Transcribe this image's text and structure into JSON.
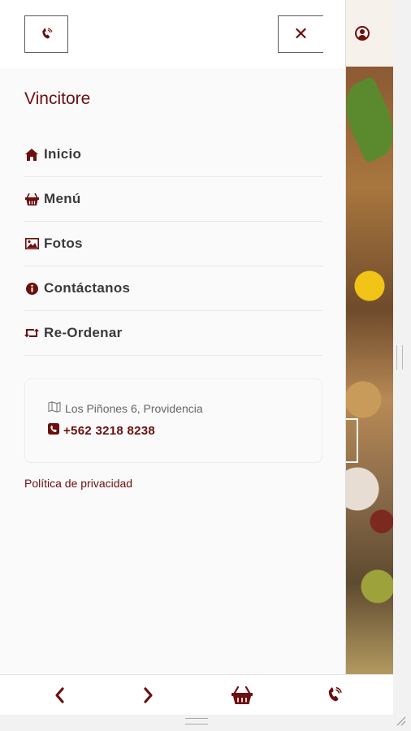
{
  "header": {
    "phone_icon": "phone-icon",
    "close_icon": "close-icon",
    "close_glyph": "✕",
    "user_icon": "user-circle-icon"
  },
  "brand": "Vincitore",
  "nav": {
    "items": [
      {
        "icon": "home-icon",
        "label": "Inicio"
      },
      {
        "icon": "basket-icon",
        "label": "Menú"
      },
      {
        "icon": "image-icon",
        "label": "Fotos"
      },
      {
        "icon": "info-icon",
        "label": "Contáctanos"
      },
      {
        "icon": "retweet-icon",
        "label": "Re-Ordenar"
      }
    ]
  },
  "contact": {
    "address_icon": "map-icon",
    "address": "Los Piñones 6, Providencia",
    "phone_icon": "phone-square-icon",
    "phone": "+562 3218 8238"
  },
  "privacy_link": "Política de privacidad",
  "bottom_bar": {
    "prev_glyph": "‹",
    "next_glyph": "›",
    "prev_icon": "chevron-left-icon",
    "next_icon": "chevron-right-icon",
    "basket_icon": "basket-icon",
    "phone_icon": "phone-icon"
  },
  "colors": {
    "accent": "#6b0f0f",
    "text": "#3a3a3a",
    "muted": "#666666"
  }
}
